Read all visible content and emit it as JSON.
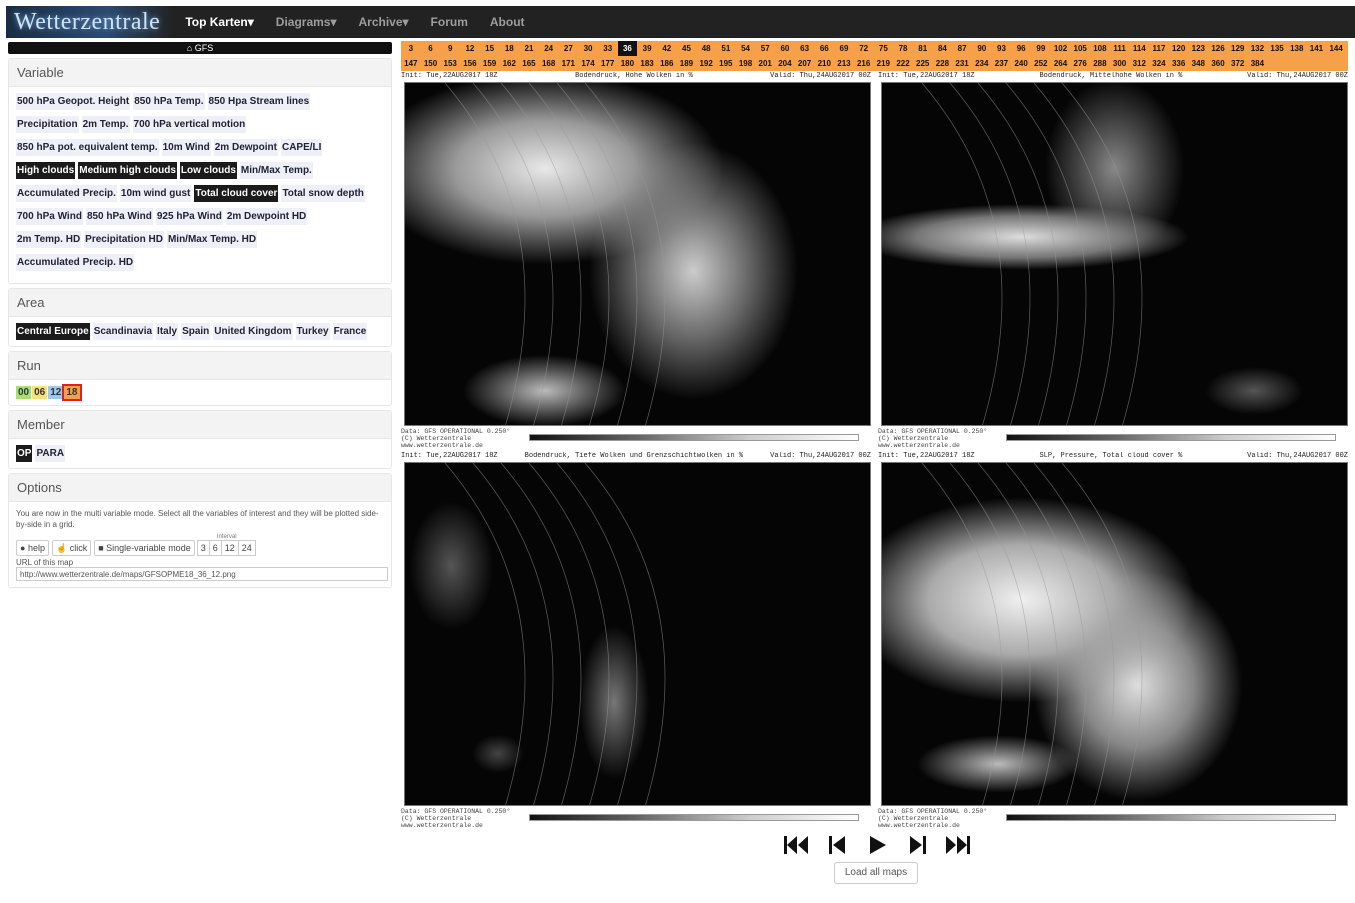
{
  "nav": {
    "logo": "Wetterzentrale",
    "items": [
      "Top Karten▾",
      "Diagrams▾",
      "Archive▾",
      "Forum",
      "About"
    ]
  },
  "model_label": "GFS",
  "variable": {
    "title": "Variable",
    "rows": [
      [
        {
          "label": "500 hPa Geopot. Height",
          "selected": false
        },
        {
          "label": "850 hPa Temp.",
          "selected": false
        },
        {
          "label": "850 Hpa Stream lines",
          "selected": false
        }
      ],
      [
        {
          "label": "Precipitation",
          "selected": false
        },
        {
          "label": "2m Temp.",
          "selected": false
        },
        {
          "label": "700 hPa vertical motion",
          "selected": false
        }
      ],
      [
        {
          "label": "850 hPa pot. equivalent temp.",
          "selected": false
        },
        {
          "label": "10m Wind",
          "selected": false
        },
        {
          "label": "2m Dewpoint",
          "selected": false
        },
        {
          "label": "CAPE/LI",
          "selected": false
        }
      ],
      [
        {
          "label": "High clouds",
          "selected": true
        },
        {
          "label": "Medium high clouds",
          "selected": true
        },
        {
          "label": "Low clouds",
          "selected": true
        },
        {
          "label": "Min/Max Temp.",
          "selected": false
        }
      ],
      [
        {
          "label": "Accumulated Precip.",
          "selected": false
        },
        {
          "label": "10m wind gust",
          "selected": false
        },
        {
          "label": "Total cloud cover",
          "selected": true
        },
        {
          "label": "Total snow depth",
          "selected": false
        }
      ],
      [
        {
          "label": "700 hPa Wind",
          "selected": false
        },
        {
          "label": "850 hPa Wind",
          "selected": false
        },
        {
          "label": "925 hPa Wind",
          "selected": false
        },
        {
          "label": "2m Dewpoint HD",
          "selected": false
        }
      ],
      [
        {
          "label": "2m Temp. HD",
          "selected": false
        },
        {
          "label": "Precipitation HD",
          "selected": false
        },
        {
          "label": "Min/Max Temp. HD",
          "selected": false
        }
      ],
      [
        {
          "label": "Accumulated Precip. HD",
          "selected": false
        }
      ]
    ]
  },
  "area": {
    "title": "Area",
    "items": [
      {
        "label": "Central Europe",
        "selected": true
      },
      {
        "label": "Scandinavia",
        "selected": false
      },
      {
        "label": "Italy",
        "selected": false
      },
      {
        "label": "Spain",
        "selected": false
      },
      {
        "label": "United Kingdom",
        "selected": false
      },
      {
        "label": "Turkey",
        "selected": false
      },
      {
        "label": "France",
        "selected": false
      }
    ]
  },
  "run": {
    "title": "Run",
    "items": [
      {
        "label": "00",
        "color": "#a8e070"
      },
      {
        "label": "06",
        "color": "#f5e27a"
      },
      {
        "label": "12",
        "color": "#9cc8f0"
      },
      {
        "label": "18",
        "color": "#f7a04a",
        "selected": true
      }
    ]
  },
  "member": {
    "title": "Member",
    "items": [
      {
        "label": "OP",
        "selected": true
      },
      {
        "label": "PARA",
        "selected": false
      }
    ]
  },
  "options": {
    "title": "Options",
    "text": "You are now in the multi variable mode. Select all the variables of interest and they will be plotted side-by-side in a grid.",
    "help": "help",
    "click": "click",
    "single": "Single-variable mode",
    "interval_label": "Interval",
    "intervals": [
      "3",
      "6",
      "12",
      "24"
    ],
    "url_label": "URL of this map",
    "url": "http://www.wetterzentrale.de/maps/GFSOPME18_36_12.png"
  },
  "timesteps": {
    "current": "36",
    "row1": [
      "3",
      "6",
      "9",
      "12",
      "15",
      "18",
      "21",
      "24",
      "27",
      "30",
      "33",
      "36",
      "39",
      "42",
      "45",
      "48",
      "51",
      "54",
      "57",
      "60",
      "63",
      "66",
      "69",
      "72",
      "75",
      "78",
      "81",
      "84",
      "87",
      "90",
      "93",
      "96",
      "99",
      "102",
      "105",
      "108",
      "111",
      "114",
      "117",
      "120",
      "123",
      "126",
      "129",
      "132",
      "135",
      "138",
      "141",
      "144"
    ],
    "row2": [
      "147",
      "150",
      "153",
      "156",
      "159",
      "162",
      "165",
      "168",
      "171",
      "174",
      "177",
      "180",
      "183",
      "186",
      "189",
      "192",
      "195",
      "198",
      "201",
      "204",
      "207",
      "210",
      "213",
      "216",
      "219",
      "222",
      "225",
      "228",
      "231",
      "234",
      "237",
      "240",
      "252",
      "264",
      "276",
      "288",
      "300",
      "312",
      "324",
      "336",
      "348",
      "360",
      "372",
      "384"
    ]
  },
  "maps": [
    {
      "init": "Init: Tue,22AUG2017 18Z",
      "title": "Bodendruck, Hohe Wolken in %",
      "valid": "Valid: Thu,24AUG2017 00Z",
      "data": "Data: GFS OPERATIONAL 0.250°",
      "copy": "(C) Wetterzentrale",
      "site": "www.wetterzentrale.de"
    },
    {
      "init": "Init: Tue,22AUG2017 18Z",
      "title": "Bodendruck, Mittelhohe Wolken in %",
      "valid": "Valid: Thu,24AUG2017 00Z",
      "data": "Data: GFS OPERATIONAL 0.250°",
      "copy": "(C) Wetterzentrale",
      "site": "www.wetterzentrale.de"
    },
    {
      "init": "Init: Tue,22AUG2017 18Z",
      "title": "Bodendruck, Tiefe Wolken und Grenzschichtwolken in %",
      "valid": "Valid: Thu,24AUG2017 00Z",
      "data": "Data: GFS OPERATIONAL 0.250°",
      "copy": "(C) Wetterzentrale",
      "site": "www.wetterzentrale.de"
    },
    {
      "init": "Init: Tue,22AUG2017 18Z",
      "title": "SLP, Pressure, Total cloud cover %",
      "valid": "Valid: Thu,24AUG2017 00Z",
      "data": "Data: GFS OPERATIONAL 0.250°",
      "copy": "(C) Wetterzentrale",
      "site": "www.wetterzentrale.de"
    }
  ],
  "load_all": "Load all maps"
}
